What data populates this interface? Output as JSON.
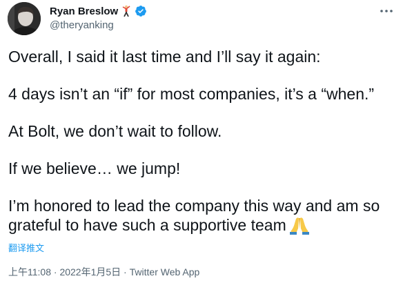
{
  "author": {
    "display_name": "Ryan Breslow",
    "handle": "@theryanking",
    "name_emoji_icon": "person-climbing-icon",
    "verified_icon": "verified-badge-icon",
    "verified_color": "#1d9bf0"
  },
  "more_icon": "more-horizontal-icon",
  "tweet": {
    "paragraphs": [
      "Overall, I said it last time and I’ll say it again:",
      "4 days isn’t an “if” for most companies, it’s a “when.”",
      "At Bolt, we don’t wait to follow.",
      "If we believe… we jump!",
      "I’m honored to lead the company this way and am so grateful to have such a supportive team"
    ],
    "last_line_part1": "I’m honored to lead the company this way and am so",
    "last_line_part2": "grateful to have such a supportive team",
    "trailing_emoji_icon": "folded-hands-icon"
  },
  "translate_label": "翻译推文",
  "meta": {
    "time": "上午11:08",
    "separator": " · ",
    "date": "2022年1月5日",
    "source": "Twitter Web App"
  },
  "colors": {
    "text_primary": "#0f1419",
    "text_secondary": "#536471",
    "link": "#1d9bf0"
  }
}
